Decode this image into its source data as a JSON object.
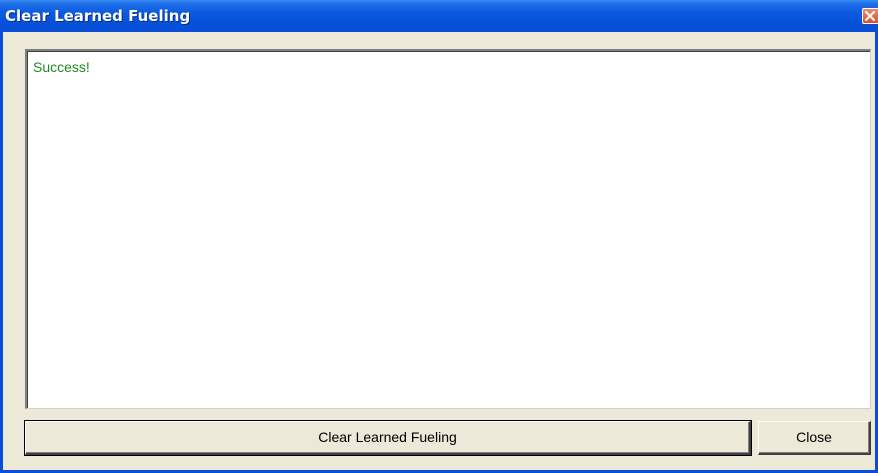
{
  "window": {
    "title": "Clear Learned Fueling"
  },
  "output": {
    "text": "Success!"
  },
  "buttons": {
    "clear_label": "Clear Learned Fueling",
    "close_label": "Close"
  },
  "colors": {
    "titlebar": "#0a4dd6",
    "success_text": "#1f8a1f",
    "dialog_background": "#ece9d8"
  }
}
